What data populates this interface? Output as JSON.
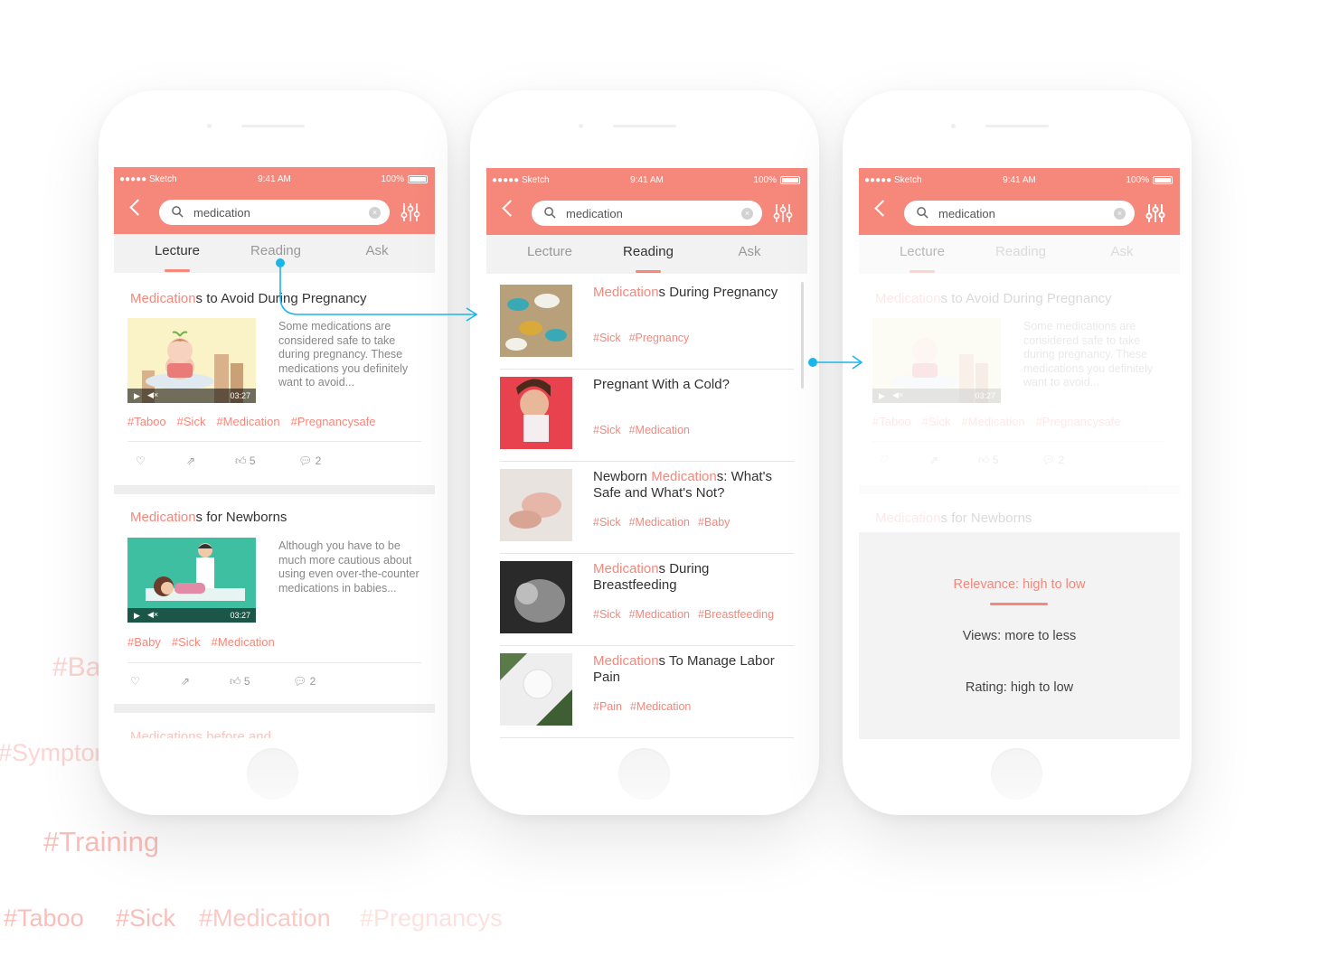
{
  "statusbar": {
    "carrier": "●●●●● Sketch",
    "time": "9:41 AM",
    "battery": "100%"
  },
  "search": {
    "query": "medication"
  },
  "tabs": [
    "Lecture",
    "Reading",
    "Ask"
  ],
  "lecture": {
    "cards": [
      {
        "title_hl": "Medication",
        "title_rest": "s to Avoid During Pregnancy",
        "desc": "Some medications are considered safe to take during pregnancy. These medications you definitely want to avoid...",
        "duration": "03:27",
        "tags": [
          "#Taboo",
          "#Sick",
          "#Medication",
          "#Pregnancysafe"
        ],
        "likes": "5",
        "comments": "2"
      },
      {
        "title_hl": "Medication",
        "title_rest": "s for Newborns",
        "desc": "Although you have to be much more cautious about using even over-the-counter medications in babies...",
        "duration": "03:27",
        "tags": [
          "#Baby",
          "#Sick",
          "#Medication"
        ],
        "likes": "5",
        "comments": "2"
      }
    ],
    "partial_title": "Medications before and … …"
  },
  "reading": {
    "items": [
      {
        "pre": "",
        "hl": "Medication",
        "post": "s During Pregnancy",
        "tags": [
          "#Sick",
          "#Pregnancy"
        ]
      },
      {
        "pre": "Pregnant With a Cold?",
        "hl": "",
        "post": "",
        "tags": [
          "#Sick",
          "#Medication"
        ]
      },
      {
        "pre": "Newborn ",
        "hl": "Medication",
        "post": "s: What's Safe and What's Not?",
        "tags": [
          "#Sick",
          "#Medication",
          "#Baby"
        ]
      },
      {
        "pre": "",
        "hl": "Medication",
        "post": "s During Breastfeeding",
        "tags": [
          "#Sick",
          "#Medication",
          "#Breastfeeding"
        ]
      },
      {
        "pre": "",
        "hl": "Medication",
        "post": "s To Manage Labor Pain",
        "tags": [
          "#Pain",
          "#Medication"
        ]
      }
    ]
  },
  "sort": {
    "options": [
      "Relevance: high to low",
      "Views: more to less",
      "Rating: high to low"
    ],
    "selected": 0
  },
  "background_tags": [
    "#Ba",
    "#Symptom",
    "#Training",
    "#Taboo",
    "#Sick",
    "#Medication",
    "#Pregnancys"
  ],
  "colors": {
    "accent": "#f6877b",
    "arrow": "#1ab6ea"
  }
}
